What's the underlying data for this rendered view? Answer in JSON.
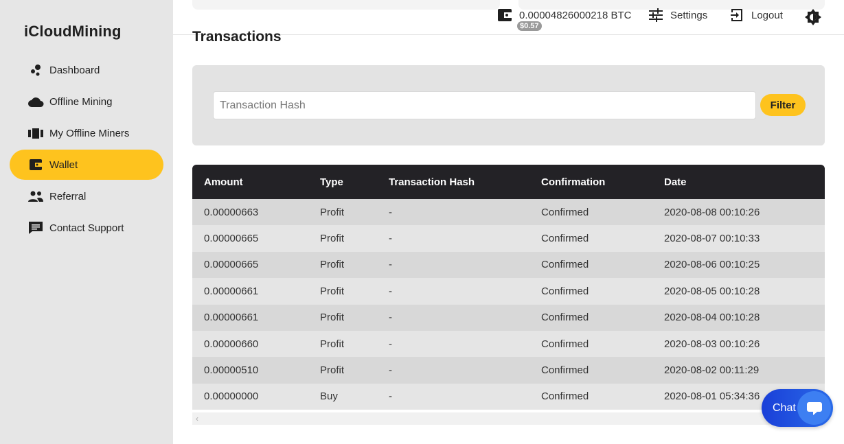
{
  "brand": "iCloudMining",
  "sidebar": {
    "items": [
      {
        "label": "Dashboard",
        "icon": "dashboard-icon"
      },
      {
        "label": "Offline Mining",
        "icon": "cloud-icon"
      },
      {
        "label": "My Offline Miners",
        "icon": "miners-icon"
      },
      {
        "label": "Wallet",
        "icon": "wallet-icon",
        "active": true
      },
      {
        "label": "Referral",
        "icon": "people-icon"
      },
      {
        "label": "Contact Support",
        "icon": "chat-icon"
      }
    ]
  },
  "topbar": {
    "balance": "0.00004826000218 BTC",
    "balance_usd": "$0.57",
    "settings": "Settings",
    "logout": "Logout",
    "theme_icon": "brightness-icon"
  },
  "page": {
    "title": "Transactions"
  },
  "filter": {
    "placeholder": "Transaction Hash",
    "value": "",
    "button": "Filter"
  },
  "table": {
    "headers": [
      "Amount",
      "Type",
      "Transaction Hash",
      "Confirmation",
      "Date"
    ],
    "rows": [
      [
        "0.00000663",
        "Profit",
        "-",
        "Confirmed",
        "2020-08-08 00:10:26"
      ],
      [
        "0.00000665",
        "Profit",
        "-",
        "Confirmed",
        "2020-08-07 00:10:33"
      ],
      [
        "0.00000665",
        "Profit",
        "-",
        "Confirmed",
        "2020-08-06 00:10:25"
      ],
      [
        "0.00000661",
        "Profit",
        "-",
        "Confirmed",
        "2020-08-05 00:10:28"
      ],
      [
        "0.00000661",
        "Profit",
        "-",
        "Confirmed",
        "2020-08-04 00:10:28"
      ],
      [
        "0.00000660",
        "Profit",
        "-",
        "Confirmed",
        "2020-08-03 00:10:26"
      ],
      [
        "0.00000510",
        "Profit",
        "-",
        "Confirmed",
        "2020-08-02 00:11:29"
      ],
      [
        "0.00000000",
        "Buy",
        "-",
        "Confirmed",
        "2020-08-01 05:34:36"
      ]
    ]
  },
  "chat": {
    "label": "Chat"
  },
  "colors": {
    "accent": "#fec31e",
    "sidebar_bg": "#e6e6e6",
    "table_header": "#232226",
    "chat_blue": "#1a3fd8"
  }
}
